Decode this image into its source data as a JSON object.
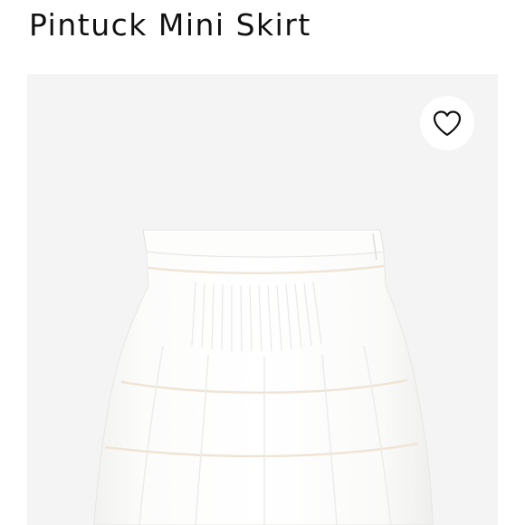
{
  "product": {
    "title": "Pintuck Mini Skirt",
    "image_subject": "white pintuck tiered mini skirt",
    "background_color": "#f4f4f4",
    "garment_color": "#fbfbfa",
    "lace_trim_color": "#efe5d6"
  },
  "actions": {
    "favorite_icon": "heart-outline-icon"
  }
}
